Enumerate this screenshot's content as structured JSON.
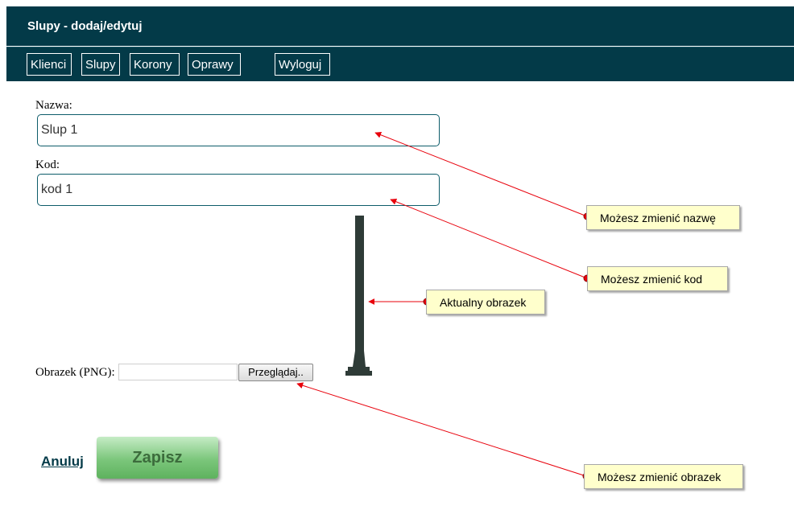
{
  "header": {
    "title": "Slupy - dodaj/edytuj"
  },
  "nav": {
    "items": [
      {
        "label": "Klienci"
      },
      {
        "label": "Slupy"
      },
      {
        "label": "Korony"
      },
      {
        "label": "Oprawy"
      },
      {
        "label": "Wyloguj"
      }
    ]
  },
  "form": {
    "name_label": "Nazwa:",
    "name_value": "Slup 1",
    "code_label": "Kod:",
    "code_value": "kod 1",
    "image_label": "Obrazek (PNG):",
    "browse_label": "Przeglądaj..",
    "cancel_label": "Anuluj",
    "save_label": "Zapisz"
  },
  "annotations": {
    "name_hint": "Możesz zmienić nazwę",
    "code_hint": "Możesz zmienić kod",
    "image_hint": "Aktualny obrazek",
    "upload_hint": "Możesz zmienić obrazek"
  },
  "colors": {
    "header_bg": "#033a48",
    "arrow": "#e8000b",
    "note_bg": "#ffffcc",
    "pole": "#2e3b37"
  }
}
